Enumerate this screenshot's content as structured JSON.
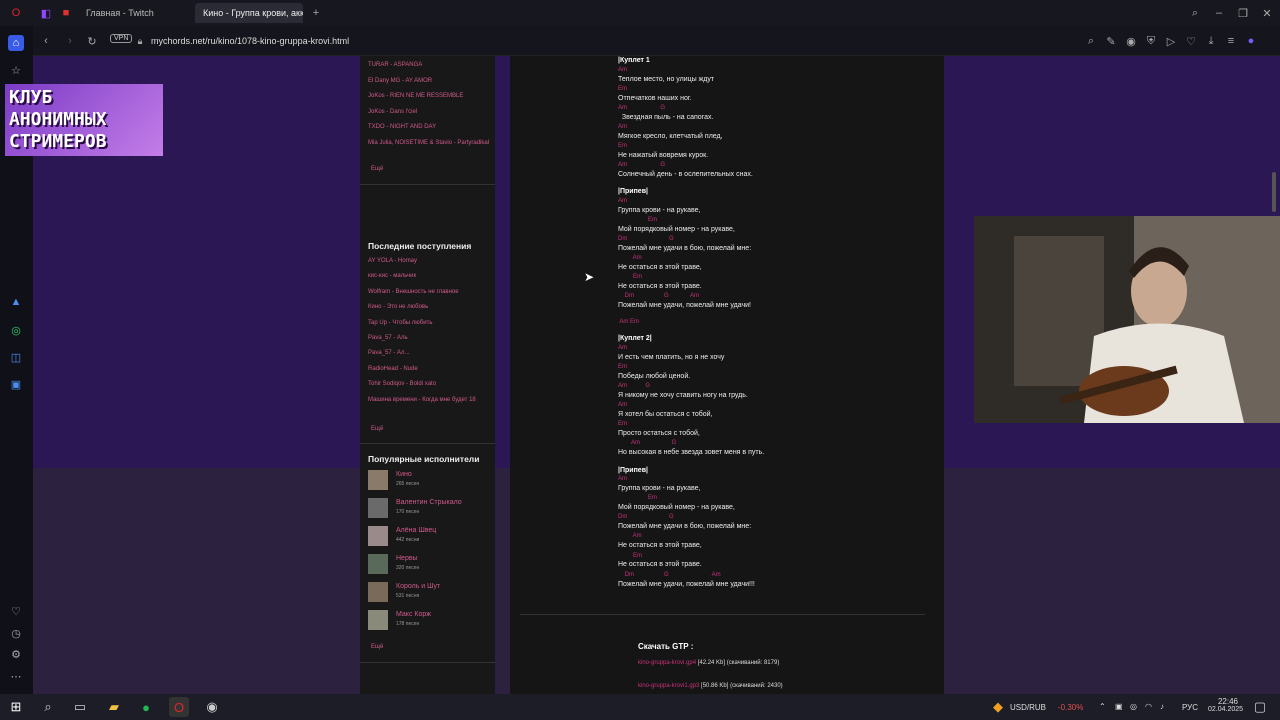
{
  "browser": {
    "tabs": [
      {
        "label": "Главная - Twitch"
      },
      {
        "label": "Кино - Группа крови, акк"
      }
    ],
    "new_tab": "+",
    "vpn": "VPN",
    "url": "mychords.net/ru/kino/1078-kino-gruppa-krovi.html"
  },
  "overlay": {
    "logo_lines": [
      "КЛУБ",
      "АНОНИМНЫХ",
      "СТРИМЕРОВ"
    ]
  },
  "sidebar": {
    "top_links": [
      "TURAR - ASPANGA",
      "El Dany MG - AY AMOR",
      "JoKos - RIEN NE ME RESSEMBLE",
      "JoKos - Dans l'ciel",
      "TXDO - NIGHT AND DAY",
      "Mia Julia, NOISETIME & Stavio - Partyradikal"
    ],
    "more_1": "Ещё",
    "recent_heading": "Последние поступления",
    "recent_links": [
      "AY YOLA - Homay",
      "кис-кис - мальчик",
      "Wolfram - Внешность не главное",
      "Кино - Это не любовь",
      "Tap Up - Чтобы любить",
      "Pava_57 - Аль",
      "Pava_57 - Ал...",
      "RadioHead - Nude",
      "Tohir Sodiqov - Boldi xato",
      "Машина времени - Когда мне будет 18"
    ],
    "more_2": "Ещё",
    "popular_heading": "Популярные исполнители",
    "artists": [
      {
        "name": "Кино",
        "count": "265 песен"
      },
      {
        "name": "Валентин Стрыкало",
        "count": "170 песен"
      },
      {
        "name": "Алёна Швец",
        "count": "442 песни"
      },
      {
        "name": "Нервы",
        "count": "320 песен"
      },
      {
        "name": "Король и Шут",
        "count": "531 песня"
      },
      {
        "name": "Макс Корж",
        "count": "178 песен"
      }
    ],
    "more_3": "Ещё"
  },
  "song": {
    "lines": [
      {
        "t": "sec",
        "text": "|Куплет 1"
      },
      {
        "t": "chord",
        "text": "Am"
      },
      {
        "t": "lyr",
        "text": "Теплое место, но улицы ждут"
      },
      {
        "t": "chord",
        "text": "Em"
      },
      {
        "t": "lyr",
        "text": "Отпечатков наших ног."
      },
      {
        "t": "chord",
        "text": "Am                    G"
      },
      {
        "t": "lyr",
        "text": "  Звездная пыль - на сапогах."
      },
      {
        "t": "chord",
        "text": "Am"
      },
      {
        "t": "lyr",
        "text": "Мягкое кресло, клетчатый плед,"
      },
      {
        "t": "chord",
        "text": "Em"
      },
      {
        "t": "lyr",
        "text": "Не нажатый вовремя курок."
      },
      {
        "t": "chord",
        "text": "Am                    G"
      },
      {
        "t": "lyr",
        "text": "Солнечный день - в ослепительных снах."
      },
      {
        "t": "gap",
        "text": ""
      },
      {
        "t": "sec",
        "text": "|Припев|"
      },
      {
        "t": "chord",
        "text": "Am"
      },
      {
        "t": "lyr",
        "text": "Группа крови - на рукаве,"
      },
      {
        "t": "chord",
        "text": "                  Em"
      },
      {
        "t": "lyr",
        "text": "Мой порядковый номер - на рукаве,"
      },
      {
        "t": "chord",
        "text": "Dm                         G"
      },
      {
        "t": "lyr",
        "text": "Пожелай мне удачи в бою, пожелай мне:"
      },
      {
        "t": "chord",
        "text": "         Am"
      },
      {
        "t": "lyr",
        "text": "Не остаться в этой траве,"
      },
      {
        "t": "chord",
        "text": "         Em"
      },
      {
        "t": "lyr",
        "text": "Не остаться в этой траве."
      },
      {
        "t": "chord",
        "text": "    Dm                  G             Am"
      },
      {
        "t": "lyr",
        "text": "Пожелай мне удачи, пожелай мне удачи!"
      },
      {
        "t": "gap",
        "text": ""
      },
      {
        "t": "chord",
        "text": " Am Em"
      },
      {
        "t": "gap",
        "text": ""
      },
      {
        "t": "sec",
        "text": "|Куплет 2|"
      },
      {
        "t": "chord",
        "text": "Am"
      },
      {
        "t": "lyr",
        "text": "И есть чем платить, но я не хочу"
      },
      {
        "t": "chord",
        "text": "Em"
      },
      {
        "t": "lyr",
        "text": "Победы любой ценой."
      },
      {
        "t": "chord",
        "text": "Am           G"
      },
      {
        "t": "lyr",
        "text": "Я никому не хочу ставить ногу на грудь."
      },
      {
        "t": "chord",
        "text": "Am"
      },
      {
        "t": "lyr",
        "text": "Я хотел бы остаться с тобой,"
      },
      {
        "t": "chord",
        "text": "Em"
      },
      {
        "t": "lyr",
        "text": "Просто остаться с тобой,"
      },
      {
        "t": "chord",
        "text": "        Am                   G"
      },
      {
        "t": "lyr",
        "text": "Но высокая в небе звезда зовет меня в путь."
      },
      {
        "t": "gap",
        "text": ""
      },
      {
        "t": "sec",
        "text": "|Припев|"
      },
      {
        "t": "chord",
        "text": "Am"
      },
      {
        "t": "lyr",
        "text": "Группа крови - на рукаве,"
      },
      {
        "t": "chord",
        "text": "                  Em"
      },
      {
        "t": "lyr",
        "text": "Мой порядковый номер - на рукаве,"
      },
      {
        "t": "chord",
        "text": "Dm                         G"
      },
      {
        "t": "lyr",
        "text": "Пожелай мне удачи в бою, пожелай мне:"
      },
      {
        "t": "chord",
        "text": "         Am"
      },
      {
        "t": "lyr",
        "text": "Не остаться в этой траве,"
      },
      {
        "t": "chord",
        "text": "         Em"
      },
      {
        "t": "lyr",
        "text": "Не остаться в этой траве."
      },
      {
        "t": "chord",
        "text": "    Dm                  G                          Am"
      },
      {
        "t": "lyr",
        "text": "Пожелай мне удачи, пожелай мне удачи!!!"
      }
    ],
    "download_heading": "Скачать GTP :",
    "downloads": [
      {
        "file": "kino-gruppa-krovi.gp4",
        "info": "[42.24 Kb] (скачиваний: 8179)"
      },
      {
        "file": "kino-gruppa-krovi1.gp3",
        "info": "[50.86 Kb] (скачиваний: 2430)"
      }
    ]
  },
  "taskbar": {
    "currency": "USD/RUB",
    "change": "-0.30%",
    "lang": "РУС",
    "time": "22:46",
    "date": "02.04.2025"
  },
  "colors": {
    "page_purple": "#2a1753",
    "link_pink": "#d05a8a",
    "chord_red": "#c8327a"
  }
}
